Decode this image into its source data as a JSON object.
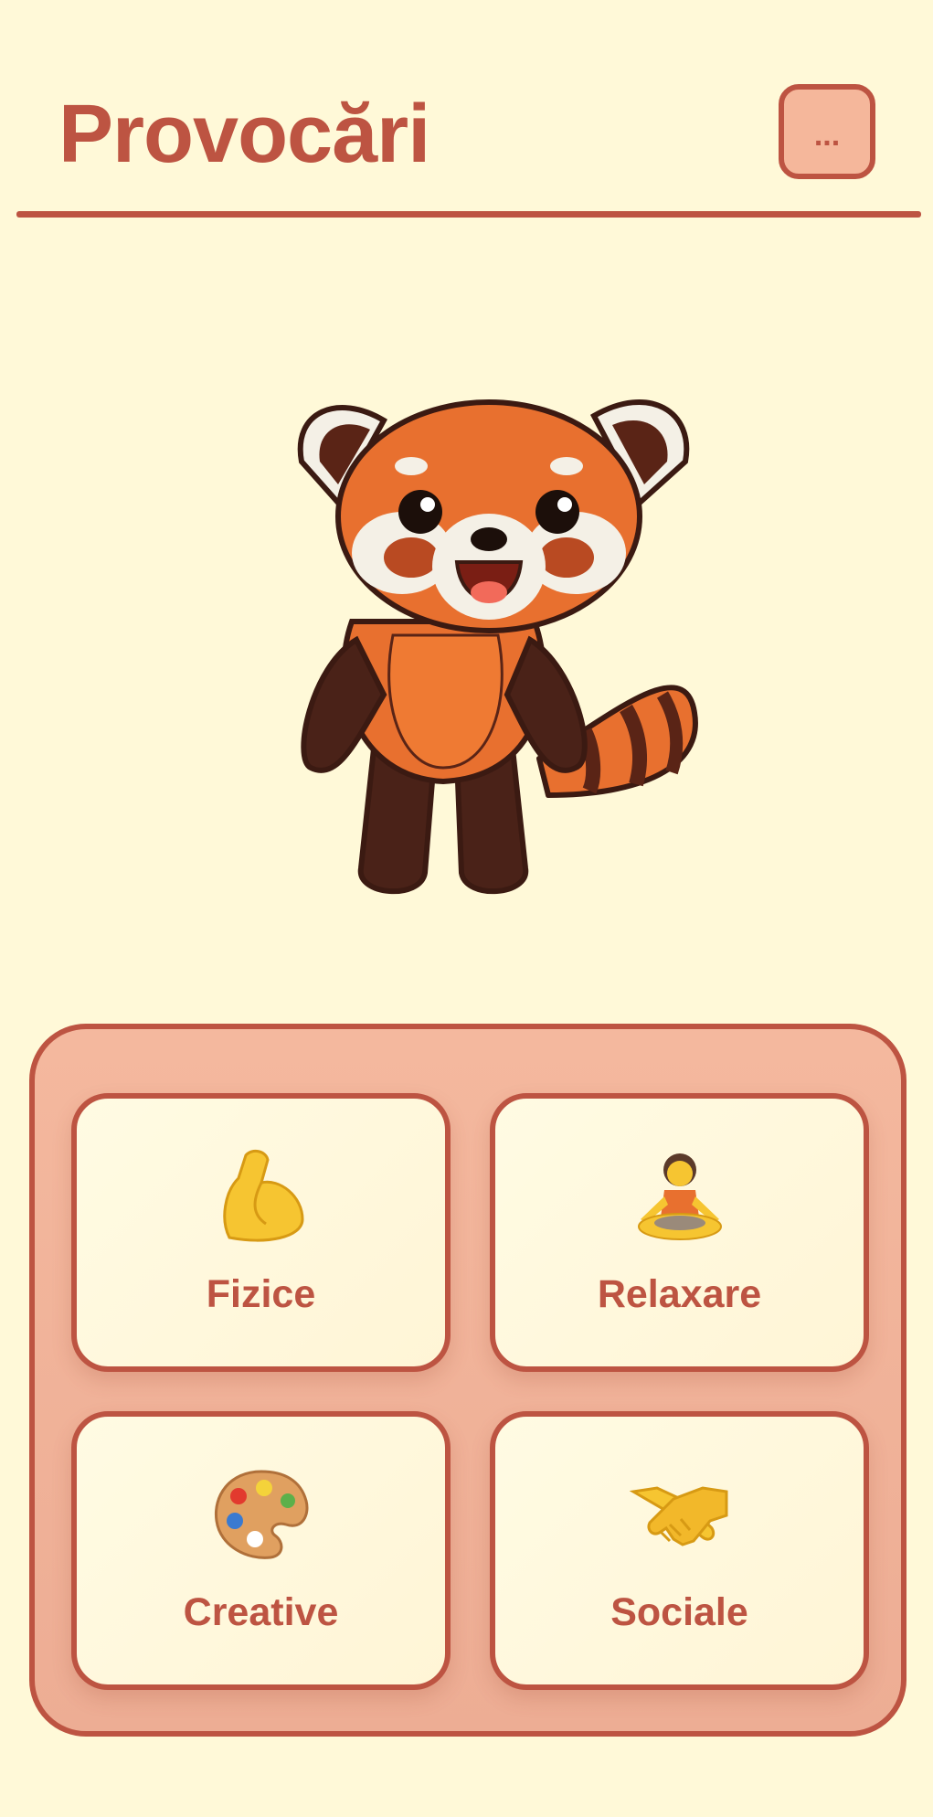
{
  "header": {
    "title": "Provocări",
    "menu_label": "..."
  },
  "mascot": {
    "icon": "red-panda-mascot"
  },
  "categories": [
    {
      "label": "Fizice",
      "icon": "flexed-biceps-icon"
    },
    {
      "label": "Relaxare",
      "icon": "lotus-position-icon"
    },
    {
      "label": "Creative",
      "icon": "artist-palette-icon"
    },
    {
      "label": "Sociale",
      "icon": "handshake-icon"
    }
  ],
  "colors": {
    "background": "#FFF9D8",
    "accent": "#BD5442",
    "panel": "#F4B89E",
    "card": "#FFFBE3"
  }
}
